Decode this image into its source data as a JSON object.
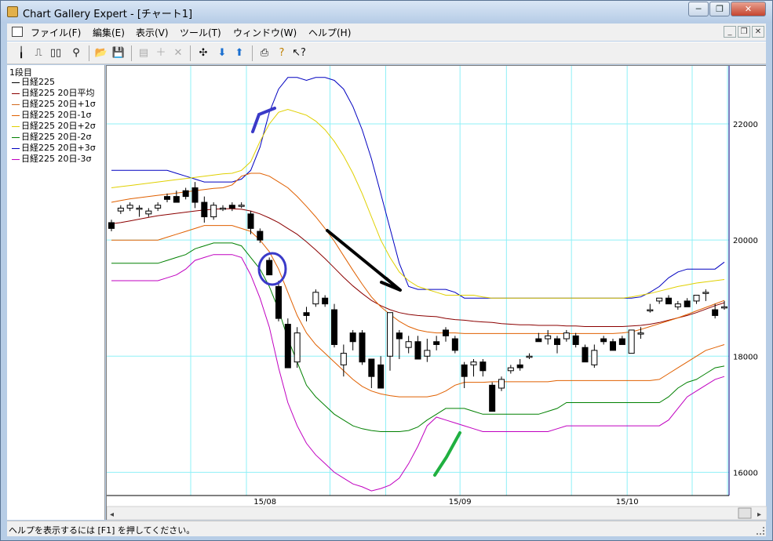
{
  "title": "Chart Gallery Expert - [チャート1]",
  "menu": [
    "ファイル(F)",
    "編集(E)",
    "表示(V)",
    "ツール(T)",
    "ウィンドウ(W)",
    "ヘルプ(H)"
  ],
  "legend": {
    "title": "1段目",
    "items": [
      {
        "label": "日経225",
        "color": "#000000"
      },
      {
        "label": "日経225 20日平均",
        "color": "#8b0000"
      },
      {
        "label": "日経225 20日+1σ",
        "color": "#d2691e"
      },
      {
        "label": "日経225 20日-1σ",
        "color": "#e06000"
      },
      {
        "label": "日経225 20日+2σ",
        "color": "#e0d000"
      },
      {
        "label": "日経225 20日-2σ",
        "color": "#008000"
      },
      {
        "label": "日経225 20日+3σ",
        "color": "#0000c0"
      },
      {
        "label": "日経225 20日-3σ",
        "color": "#c000c0"
      }
    ]
  },
  "status": "ヘルプを表示するには [F1] を押してください。",
  "chart_data": {
    "type": "candlestick",
    "x_tick_labels": [
      "15/08",
      "15/09",
      "15/10"
    ],
    "y_tick_labels": [
      "22000",
      "20000",
      "18000",
      "16000"
    ],
    "y_ticks": [
      22000,
      20000,
      18000,
      16000
    ],
    "ylim": [
      15600,
      23000
    ],
    "n": 67,
    "x_tick_index": [
      14,
      35,
      53
    ],
    "grid": true,
    "series": {
      "ma20": [
        20280,
        20300,
        20330,
        20360,
        20390,
        20420,
        20440,
        20460,
        20480,
        20500,
        20520,
        20530,
        20540,
        20540,
        20530,
        20500,
        20450,
        20380,
        20300,
        20200,
        20100,
        19970,
        19830,
        19680,
        19520,
        19360,
        19210,
        19080,
        18960,
        18870,
        18800,
        18750,
        18720,
        18700,
        18690,
        18680,
        18650,
        18630,
        18620,
        18600,
        18590,
        18580,
        18560,
        18550,
        18540,
        18540,
        18530,
        18530,
        18530,
        18520,
        18520,
        18510,
        18510,
        18510,
        18510,
        18510,
        18520,
        18530,
        18550,
        18580,
        18620,
        18660,
        18700,
        18750,
        18810,
        18870,
        18920
      ],
      "p1": [
        20650,
        20680,
        20710,
        20730,
        20750,
        20770,
        20790,
        20810,
        20830,
        20850,
        20870,
        20890,
        20900,
        20950,
        21100,
        21150,
        21150,
        21100,
        21000,
        20900,
        20750,
        20580,
        20400,
        20200,
        19980,
        19730,
        19480,
        19240,
        19020,
        18850,
        18720,
        18600,
        18510,
        18450,
        18420,
        18400,
        18400,
        18400,
        18390,
        18390,
        18390,
        18390,
        18390,
        18390,
        18390,
        18390,
        18390,
        18390,
        18390,
        18390,
        18390,
        18390,
        18390,
        18390,
        18390,
        18400,
        18420,
        18460,
        18510,
        18560,
        18610,
        18660,
        18720,
        18780,
        18840,
        18900,
        18960
      ],
      "m1": [
        20000,
        20000,
        20000,
        20000,
        20000,
        20000,
        20050,
        20100,
        20150,
        20200,
        20250,
        20250,
        20250,
        20250,
        20200,
        20150,
        20000,
        19800,
        19500,
        19100,
        18700,
        18400,
        18200,
        18050,
        17900,
        17750,
        17600,
        17480,
        17400,
        17350,
        17320,
        17300,
        17300,
        17300,
        17300,
        17330,
        17400,
        17500,
        17550,
        17550,
        17550,
        17560,
        17560,
        17560,
        17560,
        17560,
        17560,
        17560,
        17580,
        17580,
        17580,
        17580,
        17580,
        17580,
        17580,
        17580,
        17580,
        17580,
        17580,
        17600,
        17700,
        17800,
        17900,
        18000,
        18100,
        18150,
        18200
      ],
      "p2": [
        20900,
        20920,
        20940,
        20960,
        20980,
        21000,
        21020,
        21040,
        21060,
        21080,
        21100,
        21120,
        21140,
        21150,
        21200,
        21350,
        21700,
        22000,
        22200,
        22250,
        22200,
        22150,
        22050,
        21900,
        21700,
        21450,
        21150,
        20800,
        20400,
        20000,
        19700,
        19450,
        19300,
        19200,
        19150,
        19100,
        19050,
        19050,
        19050,
        19050,
        19020,
        19000,
        19000,
        19000,
        19000,
        19000,
        19000,
        19000,
        19000,
        19000,
        19000,
        19000,
        19000,
        19000,
        19000,
        19000,
        19020,
        19050,
        19080,
        19120,
        19160,
        19200,
        19230,
        19260,
        19280,
        19300,
        19320
      ],
      "m2": [
        19600,
        19600,
        19600,
        19600,
        19600,
        19600,
        19650,
        19700,
        19750,
        19850,
        19900,
        19950,
        19950,
        19950,
        19900,
        19700,
        19500,
        19200,
        18800,
        18300,
        17900,
        17500,
        17300,
        17150,
        17000,
        16900,
        16800,
        16750,
        16720,
        16700,
        16700,
        16700,
        16720,
        16780,
        16900,
        17000,
        17100,
        17100,
        17100,
        17050,
        17000,
        17000,
        17000,
        17000,
        17000,
        17000,
        17000,
        17050,
        17100,
        17200,
        17200,
        17200,
        17200,
        17200,
        17200,
        17200,
        17200,
        17200,
        17200,
        17200,
        17300,
        17450,
        17550,
        17600,
        17700,
        17800,
        17830
      ],
      "p3": [
        21200,
        21200,
        21200,
        21200,
        21200,
        21200,
        21200,
        21150,
        21100,
        21050,
        21000,
        21000,
        21000,
        21000,
        21050,
        21200,
        21600,
        22200,
        22600,
        22800,
        22800,
        22750,
        22800,
        22800,
        22750,
        22600,
        22300,
        21900,
        21400,
        20800,
        20200,
        19600,
        19200,
        19150,
        19150,
        19150,
        19150,
        19100,
        19000,
        19000,
        19000,
        19000,
        19000,
        19000,
        19000,
        19000,
        19000,
        19000,
        19000,
        19000,
        19000,
        19000,
        19000,
        19000,
        19000,
        19000,
        19000,
        19020,
        19100,
        19200,
        19350,
        19450,
        19500,
        19500,
        19500,
        19500,
        19620
      ],
      "m3": [
        19300,
        19300,
        19300,
        19300,
        19300,
        19300,
        19350,
        19400,
        19500,
        19650,
        19700,
        19750,
        19750,
        19750,
        19700,
        19400,
        19000,
        18500,
        17800,
        17200,
        16800,
        16500,
        16300,
        16150,
        16000,
        15900,
        15800,
        15750,
        15680,
        15720,
        15780,
        15900,
        16150,
        16450,
        16800,
        16950,
        16900,
        16850,
        16800,
        16750,
        16700,
        16700,
        16700,
        16700,
        16700,
        16700,
        16700,
        16700,
        16750,
        16800,
        16800,
        16800,
        16800,
        16800,
        16800,
        16800,
        16800,
        16800,
        16800,
        16800,
        16900,
        17100,
        17300,
        17400,
        17500,
        17600,
        17650
      ],
      "ohlc": [
        [
          20300,
          20350,
          20150,
          20200
        ],
        [
          20500,
          20600,
          20450,
          20550
        ],
        [
          20550,
          20650,
          20500,
          20600
        ],
        [
          20550,
          20600,
          20400,
          20550
        ],
        [
          20450,
          20550,
          20400,
          20500
        ],
        [
          20550,
          20650,
          20500,
          20600
        ],
        [
          20750,
          20800,
          20650,
          20700
        ],
        [
          20750,
          20850,
          20650,
          20650
        ],
        [
          20850,
          20900,
          20700,
          20750
        ],
        [
          20900,
          21000,
          20550,
          20650
        ],
        [
          20650,
          20750,
          20300,
          20400
        ],
        [
          20400,
          20650,
          20350,
          20600
        ],
        [
          20550,
          20600,
          20500,
          20550
        ],
        [
          20600,
          20650,
          20500,
          20550
        ],
        [
          20600,
          20650,
          20550,
          20600
        ],
        [
          20450,
          20500,
          20100,
          20200
        ],
        [
          20150,
          20200,
          19950,
          20000
        ],
        [
          19650,
          19700,
          19400,
          19400
        ],
        [
          19200,
          19300,
          18600,
          18650
        ],
        [
          18550,
          18650,
          17850,
          17800
        ],
        [
          17900,
          18500,
          17800,
          18400
        ],
        [
          18750,
          18850,
          18600,
          18700
        ],
        [
          18900,
          19150,
          18850,
          19100
        ],
        [
          19000,
          19050,
          18850,
          18900
        ],
        [
          18800,
          18900,
          18150,
          18200
        ],
        [
          17850,
          18200,
          17650,
          18050
        ],
        [
          18400,
          18450,
          18100,
          18250
        ],
        [
          18400,
          18450,
          17850,
          17900
        ],
        [
          17950,
          17950,
          17450,
          17650
        ],
        [
          17850,
          18000,
          17500,
          17450
        ],
        [
          18000,
          18750,
          17750,
          18750
        ],
        [
          18400,
          18450,
          17950,
          18300
        ],
        [
          18150,
          18350,
          18050,
          18250
        ],
        [
          18250,
          18350,
          17950,
          17950
        ],
        [
          18000,
          18300,
          17900,
          18100
        ],
        [
          18250,
          18350,
          18100,
          18200
        ],
        [
          18450,
          18500,
          18250,
          18350
        ],
        [
          18300,
          18350,
          18050,
          18100
        ],
        [
          17850,
          17900,
          17450,
          17650
        ],
        [
          17850,
          17950,
          17650,
          17900
        ],
        [
          17900,
          17950,
          17650,
          17750
        ],
        [
          17500,
          17550,
          17050,
          17050
        ],
        [
          17450,
          17650,
          17400,
          17600
        ],
        [
          17750,
          17850,
          17700,
          17800
        ],
        [
          17850,
          17950,
          17750,
          17800
        ],
        [
          18000,
          18050,
          17950,
          18000
        ],
        [
          18300,
          18400,
          18250,
          18250
        ],
        [
          18300,
          18450,
          18200,
          18350
        ],
        [
          18300,
          18350,
          18050,
          18200
        ],
        [
          18300,
          18450,
          18250,
          18400
        ],
        [
          18350,
          18400,
          18150,
          18200
        ],
        [
          18150,
          18200,
          17900,
          17900
        ],
        [
          17850,
          18200,
          17800,
          18100
        ],
        [
          18300,
          18350,
          18200,
          18250
        ],
        [
          18250,
          18300,
          18150,
          18100
        ],
        [
          18300,
          18350,
          18200,
          18200
        ],
        [
          18050,
          18450,
          18050,
          18450
        ],
        [
          18400,
          18500,
          18300,
          18400
        ],
        [
          18800,
          18900,
          18750,
          18800
        ],
        [
          18950,
          19000,
          18900,
          19000
        ],
        [
          19000,
          19050,
          18950,
          18900
        ],
        [
          18850,
          18950,
          18800,
          18900
        ],
        [
          18950,
          19000,
          18900,
          18850
        ],
        [
          18950,
          19000,
          18900,
          19050
        ],
        [
          19100,
          19150,
          18950,
          19100
        ],
        [
          18800,
          18900,
          18650,
          18700
        ],
        [
          18850,
          18950,
          18800,
          18850
        ]
      ]
    }
  }
}
